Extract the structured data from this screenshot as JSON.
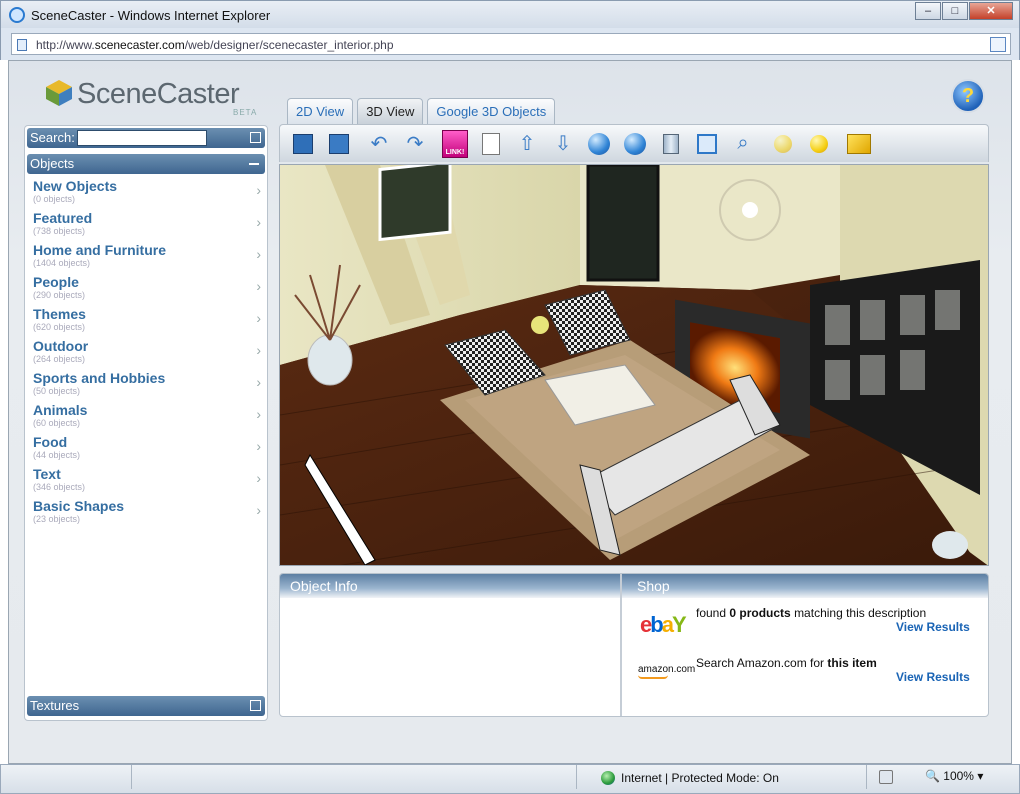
{
  "window": {
    "title": "SceneCaster - Windows Internet Explorer",
    "min": "–",
    "max": "□",
    "close": "✕"
  },
  "address": {
    "url_prefix": "http://www.",
    "url_domain": "scenecaster.com",
    "url_path": "/web/designer/scenecaster_interior.php"
  },
  "logo": {
    "text": "SceneCaster",
    "beta": "BETA"
  },
  "help": {
    "label": "?"
  },
  "tabs": [
    {
      "label": "2D View"
    },
    {
      "label": "3D View"
    },
    {
      "label": "Google 3D Objects"
    }
  ],
  "toolbar": {
    "link_label": "LINK!"
  },
  "sidebar": {
    "search_label": "Search:",
    "objects_label": "Objects",
    "textures_label": "Textures",
    "categories": [
      {
        "name": "New Objects",
        "count": "(0 objects)"
      },
      {
        "name": "Featured",
        "count": "(738 objects)"
      },
      {
        "name": "Home and Furniture",
        "count": "(1404 objects)"
      },
      {
        "name": "People",
        "count": "(290 objects)"
      },
      {
        "name": "Themes",
        "count": "(620 objects)"
      },
      {
        "name": "Outdoor",
        "count": "(264 objects)"
      },
      {
        "name": "Sports and Hobbies",
        "count": "(50 objects)"
      },
      {
        "name": "Animals",
        "count": "(60 objects)"
      },
      {
        "name": "Food",
        "count": "(44 objects)"
      },
      {
        "name": "Text",
        "count": "(346 objects)"
      },
      {
        "name": "Basic Shapes",
        "count": "(23 objects)"
      }
    ]
  },
  "object_info": {
    "title": "Object Info"
  },
  "shop": {
    "title": "Shop",
    "ebay_found": "found",
    "ebay_count": "0 products",
    "ebay_rest": "matching this description",
    "view_results": "View Results",
    "amazon_logo": "amazon.com",
    "amazon_text": "Search Amazon.com for",
    "amazon_bold": "this item"
  },
  "status": {
    "zone": "Internet | Protected Mode: On",
    "zoom": "100%"
  }
}
